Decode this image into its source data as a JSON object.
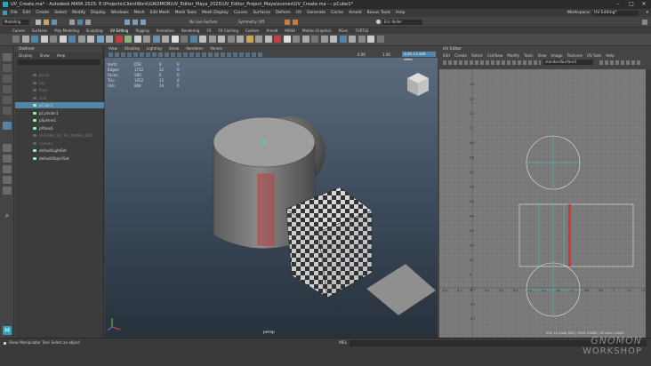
{
  "window": {
    "title": "UV_Create.ma* - Autodesk MAYA 2025: E:\\Projects\\ClientWork\\GNOMON\\UV_Editor_Maya_2025\\UV_Editor_Project_Maya\\scenes\\UV_Create.ma --- pCube1*"
  },
  "menubar": {
    "items": [
      "File",
      "Edit",
      "Create",
      "Select",
      "Modify",
      "Display",
      "Windows",
      "Mesh",
      "Edit Mesh",
      "Mesh Tools",
      "Mesh Display",
      "Curves",
      "Surfaces",
      "Deform",
      "UV",
      "Generate",
      "Cache",
      "Arnold",
      "Bonus Tools",
      "Help"
    ],
    "workspace_label": "Workspace:",
    "workspace_value": "UV Editing*"
  },
  "statusline": {
    "mode": "Modeling",
    "live_surface": "No Live Surface",
    "symmetry": "Symmetry: Off",
    "user": "Eric Keller"
  },
  "shelf": {
    "tabs": [
      "Curves",
      "Surfaces",
      "Poly Modeling",
      "Sculpting",
      "UV Editing",
      "Rigging",
      "Animation",
      "Rendering",
      "FX",
      "FX Caching",
      "Custom",
      "Arnold",
      "MASH",
      "Motion Graphics",
      "XGen",
      "TURTLE"
    ]
  },
  "outliner": {
    "title": "Outliner",
    "menu": [
      "Display",
      "Show",
      "Help"
    ],
    "items": [
      {
        "label": "persp",
        "dim": true
      },
      {
        "label": "top",
        "dim": true
      },
      {
        "label": "front",
        "dim": true
      },
      {
        "label": "side",
        "dim": true
      },
      {
        "label": "pCube1",
        "dim": false,
        "selected": true
      },
      {
        "label": "pCylinder1",
        "dim": false
      },
      {
        "label": "pSphere1",
        "dim": false
      },
      {
        "label": "pPlane1",
        "dim": false
      },
      {
        "label": "UVEditor_UV_Tex_texture_BG1",
        "dim": true
      },
      {
        "label": "camera",
        "dim": true
      },
      {
        "label": "defaultLightSet",
        "dim": false
      },
      {
        "label": "defaultObjectSet",
        "dim": false
      }
    ]
  },
  "viewport": {
    "menu": [
      "View",
      "Shading",
      "Lighting",
      "Show",
      "Renderer",
      "Panels"
    ],
    "field1": "0.00",
    "field2": "1.00",
    "colorspace": "ACES 1.0 SDR-video",
    "camera_label": "persp",
    "hud": [
      {
        "label": "Verts:",
        "a": "658",
        "b": "8",
        "c": "0"
      },
      {
        "label": "Edges:",
        "a": "1712",
        "b": "12",
        "c": "0"
      },
      {
        "label": "Faces:",
        "a": "580",
        "b": "6",
        "c": "0"
      },
      {
        "label": "Tris:",
        "a": "1052",
        "b": "12",
        "c": "0"
      },
      {
        "label": "UVs:",
        "a": "868",
        "b": "14",
        "c": "0"
      }
    ]
  },
  "uv_editor": {
    "title": "UV Editor",
    "menu": [
      "Edit",
      "Create",
      "Select",
      "Cut/Sew",
      "Modify",
      "Tools",
      "View",
      "Image",
      "Textures",
      "UV Sets",
      "Help"
    ],
    "uvset": "standardSurface1",
    "v_ticks": [
      "1.3",
      "1.2",
      "1.1",
      "1",
      "0.9",
      "0.8",
      "0.7",
      "0.6",
      "0.5",
      "0.4",
      "0.3",
      "0.2",
      "0.1",
      "0",
      "-0.1",
      "-0.2",
      "-0.3"
    ],
    "u_ticks": [
      "-0.2",
      "-0.1",
      "0",
      "0.1",
      "0.2",
      "0.3",
      "0.4",
      "0.5",
      "0.6",
      "0.7",
      "0.8",
      "0.9",
      "1",
      "1.1",
      "1.2"
    ],
    "footer": "UVs: 14 (cube_001) ; Shell: 0.0000 ; UV Area: 1.0000",
    "side_tabs": [
      "Attribute Editor",
      "Modeling Toolkit",
      "UV Toolkit"
    ]
  },
  "statusbar": {
    "help": "Show Manipulator Tool: Select an object.",
    "mel_label": "MEL"
  },
  "watermark": {
    "brand": "GNOMON",
    "sub": "WORKSHOP"
  },
  "colors": {
    "accent_blue": "#5285a6",
    "selection_red": "#d83434",
    "uv_cyan": "#3fd0d0"
  }
}
